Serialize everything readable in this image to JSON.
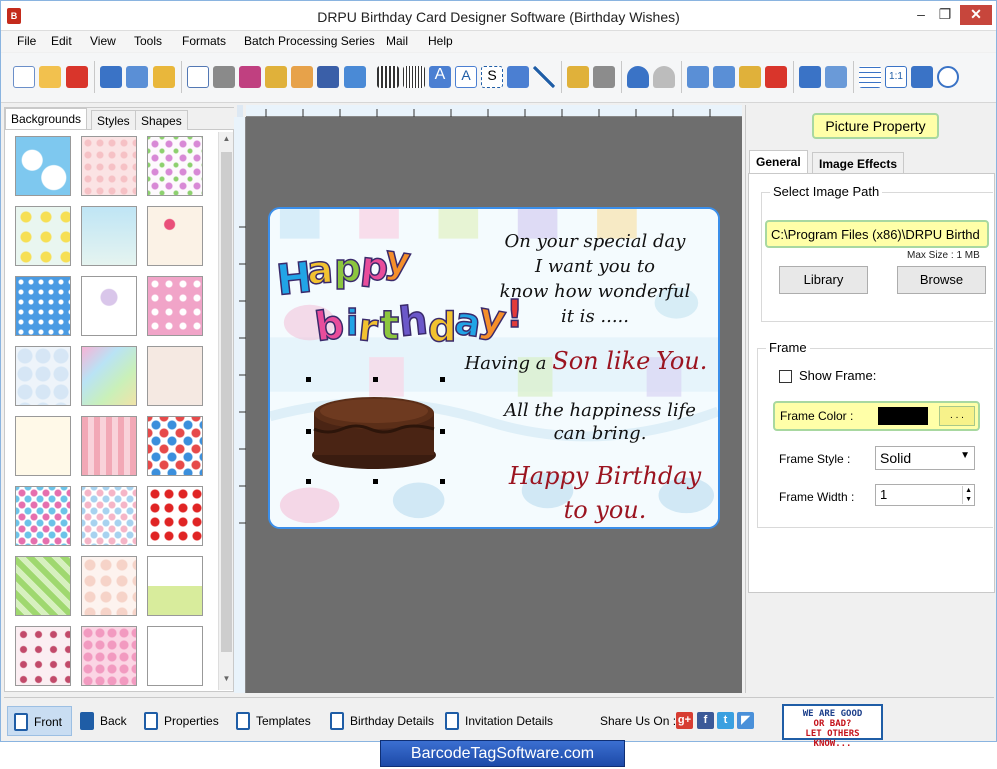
{
  "window": {
    "title": "DRPU Birthday Card Designer Software (Birthday Wishes)",
    "minimize": "–",
    "maximize": "❐",
    "close": "✕"
  },
  "menu": [
    "File",
    "Edit",
    "View",
    "Tools",
    "Formats",
    "Batch Processing Series",
    "Mail",
    "Help"
  ],
  "left_panel": {
    "tabs": [
      "Backgrounds",
      "Styles",
      "Shapes"
    ],
    "active_tab": "Backgrounds"
  },
  "card": {
    "lines_top": [
      "On your special day",
      "I want you to",
      "know how wonderful",
      "it is ....."
    ],
    "having": "Having a",
    "son": "Son like",
    "you": "You.",
    "lines_mid": [
      "All the happiness life",
      "can bring."
    ],
    "wish_1": "Happy Birthday",
    "wish_2": "to you."
  },
  "right_panel": {
    "header_button": "Picture Property",
    "tabs": [
      "General",
      "Image Effects"
    ],
    "active_tab": "General",
    "select_image_path_label": "Select Image Path",
    "image_path": "C:\\Program Files (x86)\\DRPU Birthd",
    "max_size": "Max Size : 1 MB",
    "library_button": "Library",
    "browse_button": "Browse",
    "frame_group": "Frame",
    "show_frame_label": "Show Frame:",
    "show_frame_checked": false,
    "frame_color_label": "Frame Color :",
    "frame_color_value": "#000000",
    "frame_color_button": ". . .",
    "frame_style_label": "Frame Style :",
    "frame_style_value": "Solid",
    "frame_width_label": "Frame Width :",
    "frame_width_value": "1"
  },
  "bottom_bar": {
    "items": [
      "Front",
      "Back",
      "Properties",
      "Templates",
      "Birthday Details",
      "Invitation Details"
    ],
    "active": "Front",
    "share_label": "Share Us On :",
    "share_icons": [
      "google-plus",
      "facebook",
      "twitter",
      "share"
    ],
    "feedback_lines": [
      "WE ARE GOOD",
      "OR BAD?",
      "LET OTHERS KNOW..."
    ]
  },
  "brand": "BarcodeTagSoftware.com"
}
